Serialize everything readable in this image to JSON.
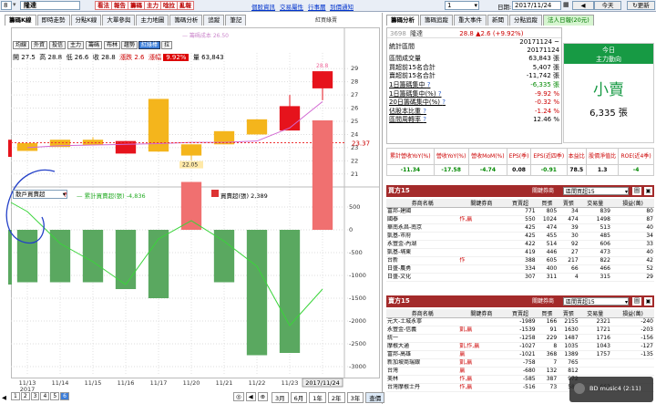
{
  "topbar": {
    "stock_code": "8",
    "stock_name": "隆達",
    "buttons": [
      "看法",
      "報告",
      "籌碼",
      "主力",
      "唸拉",
      "亂報"
    ],
    "links": [
      "個股資訊",
      "交易屬性",
      "行事曆",
      "到價通知"
    ],
    "dropdown": "1",
    "date_label": "日期:",
    "date_value": "2017/11/24",
    "today_label": "今天",
    "refresh_label": "更新"
  },
  "left": {
    "tabs": [
      "籌碼K線",
      "即時走勢",
      "分點K線",
      "大單參與",
      "主力地圖",
      "籌碼分析",
      "追蹤",
      "筆記"
    ],
    "right_note": "紅買綠賣",
    "sub_buttons": [
      "均線",
      "外資",
      "投信",
      "主力",
      "籌碼",
      "布林",
      "趨勢",
      "紅綠棒",
      "拉"
    ],
    "ohlc": {
      "o_label": "開",
      "o": "27.5",
      "h_label": "高",
      "h": "28.8",
      "l_label": "低",
      "l": "26.6",
      "c_label": "收",
      "c": "28.8",
      "chg_label": "漲跌",
      "chg": "2.6",
      "pct_label": "漲幅",
      "pct": "9.92%",
      "v_label": "量",
      "v": "63,843"
    },
    "ma_legend": "— 籌碼成本 26.50",
    "last_label": "23.37",
    "high_mark": "28.8",
    "low_mark": "22.05",
    "price_axis": [
      "29",
      "28",
      "27",
      "26",
      "25",
      "24",
      "23",
      "22",
      "21"
    ],
    "lower_selector": "散戶買賣超",
    "lower_legend_1": "— 累計買賣超(張) -4,836",
    "lower_legend_2": "買賣超(張) 2,389",
    "vol_axis": [
      "500",
      "0",
      "-500",
      "-1000",
      "-1500",
      "-2000",
      "-2500",
      "-3000"
    ],
    "dates": [
      "11/13",
      "11/14",
      "11/15",
      "11/16",
      "11/17",
      "11/20",
      "11/21",
      "11/22",
      "11/23",
      "2017/11/24"
    ],
    "year": "2017",
    "pages": [
      "1",
      "2",
      "3",
      "4",
      "5",
      "6"
    ],
    "range_btns": [
      "3月",
      "6月",
      "1年",
      "2年",
      "3年",
      "查價"
    ]
  },
  "right": {
    "tabs": [
      "籌碼分析",
      "籌碼追蹤",
      "重大事件",
      "新聞",
      "分點追蹤",
      "法人日報(20元)"
    ],
    "code": "3698",
    "name": "隆達",
    "price": "28.8",
    "change": "▲2.6 (+9.92%)",
    "stats": [
      {
        "label": "統計區間",
        "value": "20171124 ~ 20171124"
      },
      {
        "label": "區間成交量",
        "value": "63,843 張"
      },
      {
        "label": "買超前15名合計",
        "value": "5,407 張"
      },
      {
        "label": "賣超前15名合計",
        "value": "-11,742 張"
      },
      {
        "label": "1日籌碼集中",
        "value": "-6,335 張"
      },
      {
        "label": "1日籌碼集中(%)",
        "value": "-9.92 %"
      },
      {
        "label": "20日籌碼集中(%)",
        "value": "-0.32 %"
      },
      {
        "label": "佔股本比重",
        "value": "-1.24 %"
      },
      {
        "label": "區間周轉率",
        "value": "12.46 %"
      }
    ],
    "today_box": {
      "title1": "今日",
      "title2": "主力動向",
      "action": "小賣",
      "amount": "6,335 張"
    },
    "metrics_head": [
      "累計營收YoY(%)",
      "營收YoY(%)",
      "營收MoM(%)",
      "EPS(季)",
      "EPS(近四季)",
      "本益比",
      "股價淨值比",
      "ROE(近4季)"
    ],
    "metrics_val": [
      "-11.34",
      "-17.58",
      "-4.74",
      "0.08",
      "-0.91",
      "78.5",
      "1.3",
      "-4"
    ],
    "buy": {
      "title": "買方15",
      "sel_label": "關鍵券商",
      "sel": "區間買超15",
      "btn": "圖",
      "head": [
        "券商名稱",
        "關鍵券商",
        "買賣超",
        "買張",
        "賣張",
        "交易量",
        "損益(萬)"
      ],
      "rows": [
        [
          "富邦-建國",
          "",
          "771",
          "805",
          "34",
          "839",
          "80"
        ],
        [
          "國泰",
          "作,贏",
          "550",
          "1024",
          "474",
          "1498",
          "87"
        ],
        [
          "華南永昌-南京",
          "",
          "425",
          "474",
          "39",
          "513",
          "40"
        ],
        [
          "凱基-市府",
          "",
          "425",
          "455",
          "30",
          "485",
          "34"
        ],
        [
          "永豐金-內湖",
          "",
          "422",
          "514",
          "92",
          "606",
          "33"
        ],
        [
          "凱基-埔東",
          "",
          "419",
          "446",
          "27",
          "473",
          "40"
        ],
        [
          "台新",
          "作",
          "388",
          "605",
          "217",
          "822",
          "42"
        ],
        [
          "日盛-農勇",
          "",
          "334",
          "400",
          "66",
          "466",
          "52"
        ],
        [
          "日盛-文化",
          "",
          "307",
          "311",
          "4",
          "315",
          "29"
        ]
      ]
    },
    "sell": {
      "title": "賣方15",
      "sel_label": "關鍵券商",
      "sel": "區間賣超15",
      "btn": "圖",
      "head": [
        "券商名稱",
        "關鍵券商",
        "買賣超",
        "買張",
        "賣張",
        "交易量",
        "損益(萬)"
      ],
      "rows": [
        [
          "元大-土城永寧",
          "",
          "-1989",
          "166",
          "2155",
          "2321",
          "-240"
        ],
        [
          "永豐金-信義",
          "凱,贏",
          "-1539",
          "91",
          "1630",
          "1721",
          "-203"
        ],
        [
          "統一",
          "",
          "-1258",
          "229",
          "1487",
          "1716",
          "-156"
        ],
        [
          "摩根大通",
          "凱,作,贏",
          "-1027",
          "8",
          "1035",
          "1043",
          "-127"
        ],
        [
          "富邦-高雄",
          "贏",
          "-1021",
          "368",
          "1389",
          "1757",
          "-135"
        ],
        [
          "新加坡商瑞銀",
          "凱,贏",
          "-758",
          "7",
          "765",
          "",
          ""
        ],
        [
          "台灣",
          "贏",
          "-680",
          "132",
          "812",
          "",
          ""
        ],
        [
          "美林",
          "作,贏",
          "-585",
          "387",
          "972",
          "",
          ""
        ],
        [
          "台灣摩根士丹",
          "作,贏",
          "-516",
          "73",
          "589",
          "662",
          ""
        ]
      ]
    }
  },
  "overlay": {
    "title": "BD music4 (2:11)"
  },
  "chart_data": {
    "type": "candlestick+bar+line",
    "x": [
      "11/13",
      "11/14",
      "11/15",
      "11/16",
      "11/17",
      "11/20",
      "11/21",
      "11/22",
      "11/23",
      "11/24"
    ],
    "candles": [
      {
        "o": 22.75,
        "c": 23.35,
        "h": 23.35,
        "l": 22.75,
        "color": "orange"
      },
      {
        "o": 23.05,
        "c": 23.6,
        "h": 23.6,
        "l": 23.05,
        "color": "orange"
      },
      {
        "o": 23.2,
        "c": 23.6,
        "h": 23.8,
        "l": 23.2,
        "color": "orange"
      },
      {
        "o": 23.5,
        "c": 22.55,
        "h": 23.5,
        "l": 22.55,
        "color": "red"
      },
      {
        "o": 26.7,
        "c": 22.7,
        "h": 26.7,
        "l": 22.7,
        "color": "orange"
      },
      {
        "o": 23.25,
        "c": 22.4,
        "h": 23.25,
        "l": 22.05,
        "color": "orange"
      },
      {
        "o": 24.25,
        "c": 23.25,
        "h": 24.25,
        "l": 23.25,
        "color": "orange"
      },
      {
        "o": 25.15,
        "c": 24.0,
        "h": 25.15,
        "l": 24.0,
        "color": "orange"
      },
      {
        "o": 24.3,
        "c": 26.15,
        "h": 27.0,
        "l": 24.3,
        "color": "red"
      },
      {
        "o": 27.5,
        "c": 28.8,
        "h": 28.8,
        "l": 26.6,
        "color": "red"
      }
    ],
    "ma": [
      23.0,
      23.15,
      23.2,
      23.25,
      23.3,
      23.4,
      23.4,
      23.5,
      24.5,
      26.5
    ],
    "ylim": [
      20.5,
      29.5
    ],
    "net": [
      -1150,
      -1150,
      -1150,
      -1300,
      -1500,
      1050,
      -1150,
      -2750,
      -2700,
      2400
    ],
    "cum": [
      400,
      -300,
      -700,
      -1200,
      -200,
      200,
      -250,
      -800,
      -2100,
      -1300
    ],
    "ylim2": [
      -3200,
      600
    ]
  }
}
